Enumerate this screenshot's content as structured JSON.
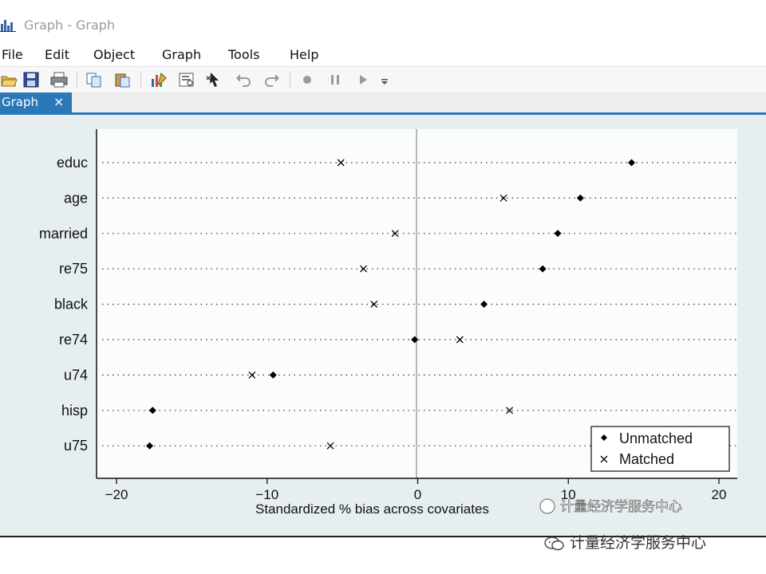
{
  "window": {
    "title": "Graph - Graph"
  },
  "menu": {
    "items": [
      "File",
      "Edit",
      "Object",
      "Graph",
      "Tools",
      "Help"
    ]
  },
  "toolbar": {
    "buttons": [
      "open-icon",
      "save-icon",
      "print-icon",
      "copy-icon",
      "paste-icon",
      "graph-editor-icon",
      "rename-icon",
      "pointer-tool-icon",
      "undo-icon",
      "redo-icon",
      "record-icon",
      "pause-icon",
      "play-icon",
      "more-icon"
    ]
  },
  "tab": {
    "label": "Graph",
    "close": "×"
  },
  "chart_data": {
    "type": "scatter",
    "title": "",
    "xlabel": "Standardized % bias across covariates",
    "ylabel": "",
    "xlim": [
      -21,
      21
    ],
    "xticks": [
      -20,
      -10,
      0,
      10,
      20
    ],
    "reference_line_x": 0,
    "grid": "dotted horizontal lines at each category",
    "legend_position": "bottom-right",
    "categories": [
      "educ",
      "age",
      "married",
      "re75",
      "black",
      "re74",
      "u74",
      "hisp",
      "u75"
    ],
    "series": [
      {
        "name": "Unmatched",
        "marker": "diamond",
        "color": "#000000",
        "values": [
          14.2,
          10.8,
          9.3,
          8.3,
          4.4,
          -0.2,
          -9.6,
          -17.6,
          -17.8
        ]
      },
      {
        "name": "Matched",
        "marker": "x",
        "color": "#000000",
        "values": [
          -5.1,
          5.7,
          -1.5,
          -3.6,
          -2.9,
          2.8,
          -11.0,
          6.1,
          -5.8
        ]
      }
    ]
  },
  "watermark": {
    "text": "计量经济学服务中心",
    "overlay_text": "计量经济学服务中心"
  },
  "colors": {
    "tab_accent": "#2a78b7",
    "canvas_bg": "#e6eeef",
    "plot_bg": "#fbfcfc"
  }
}
